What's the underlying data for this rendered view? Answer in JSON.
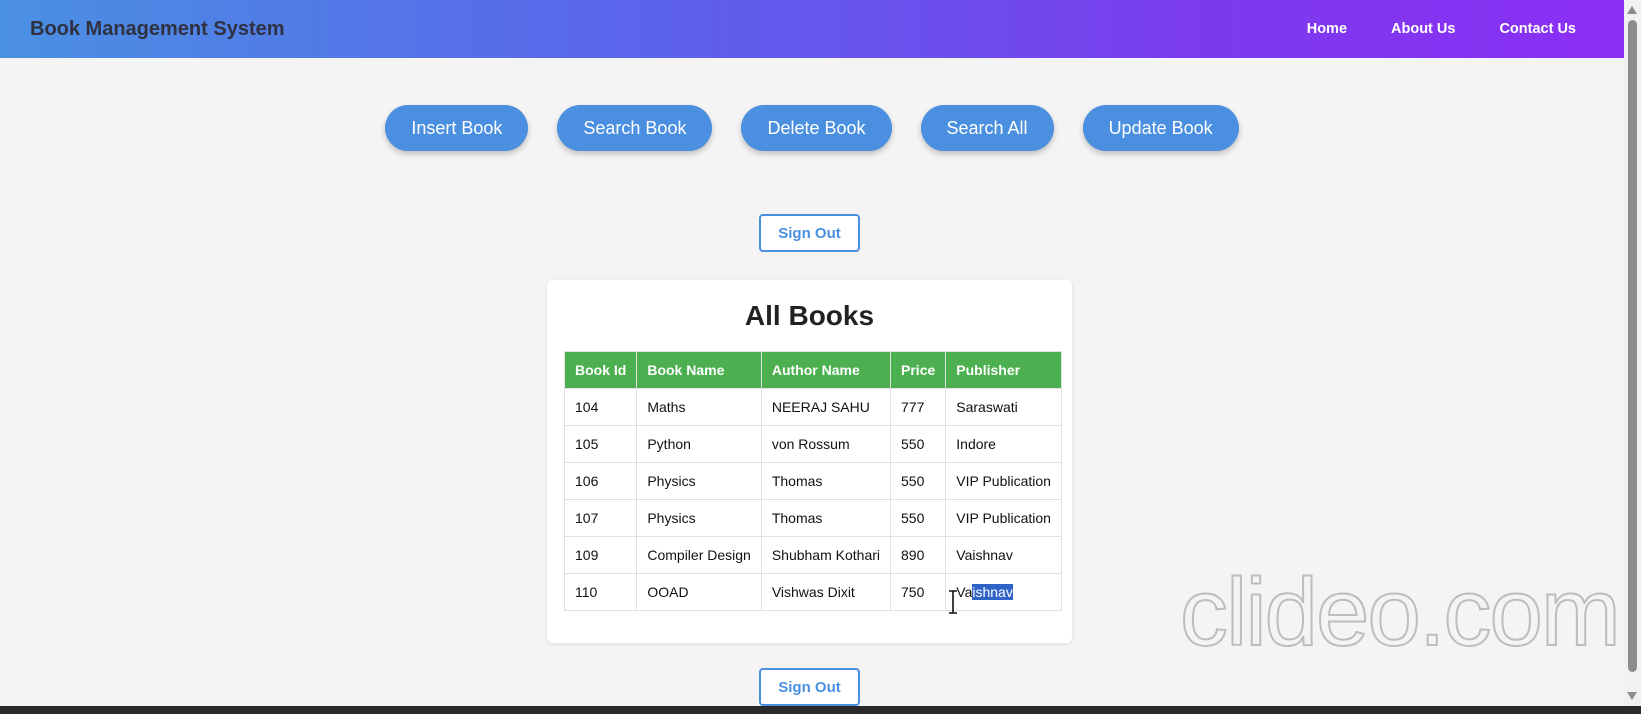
{
  "navbar": {
    "brand": "Book Management System",
    "links": [
      "Home",
      "About Us",
      "Contact Us"
    ]
  },
  "actions": [
    "Insert Book",
    "Search Book",
    "Delete Book",
    "Search All",
    "Update Book"
  ],
  "sign_out_label": "Sign Out",
  "card": {
    "title": "All Books",
    "columns": [
      "Book Id",
      "Book Name",
      "Author Name",
      "Price",
      "Publisher"
    ],
    "rows": [
      [
        "104",
        "Maths",
        "NEERAJ SAHU",
        "777",
        "Saraswati"
      ],
      [
        "105",
        "Python",
        "von Rossum",
        "550",
        "Indore"
      ],
      [
        "106",
        "Physics",
        "Thomas",
        "550",
        "VIP Publication"
      ],
      [
        "107",
        "Physics",
        "Thomas",
        "550",
        "VIP Publication"
      ],
      [
        "109",
        "Compiler Design",
        "Shubham Kothari",
        "890",
        "Vaishnav"
      ],
      [
        "110",
        "OOAD",
        "Vishwas Dixit",
        "750",
        "Vaishnav"
      ]
    ],
    "selection": {
      "row": 5,
      "col": 4,
      "before": "Va",
      "selected": "ishnav"
    }
  },
  "watermark": "clideo.com",
  "colors": {
    "accent": "#4a8fe0",
    "header_green": "#4caf50",
    "nav_gradient_start": "#4a90e2",
    "nav_gradient_end": "#8b2ff5"
  }
}
